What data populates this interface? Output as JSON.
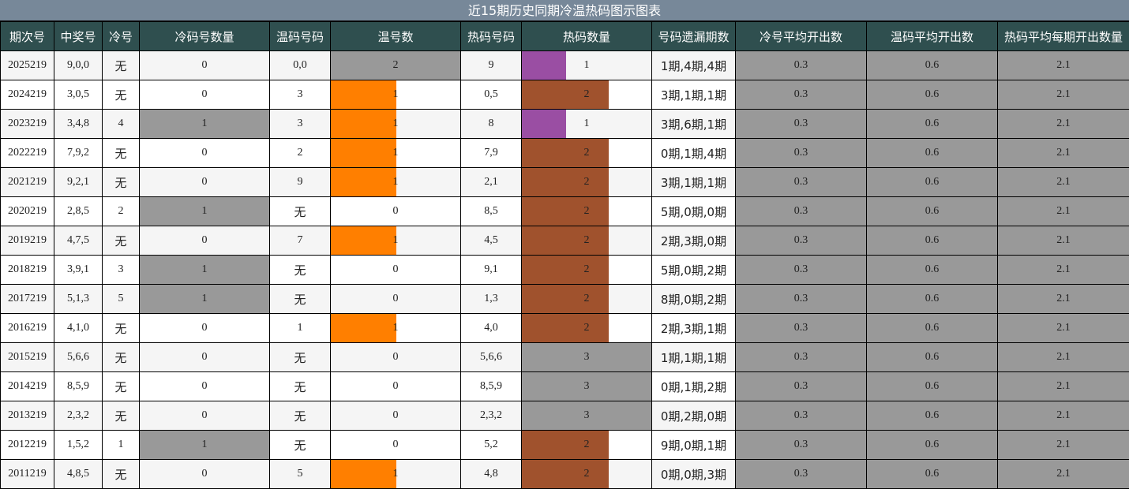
{
  "title": "近15期历史同期冷温热码图示图表",
  "headers": [
    "期次号",
    "中奖号",
    "冷号",
    "冷码号数量",
    "温码号码",
    "温号数",
    "热码号码",
    "热码数量",
    "号码遗漏期数",
    "冷号平均开出数",
    "温码平均开出数",
    "热码平均每期开出数量"
  ],
  "colors": {
    "header_bg": "#2f4f4f",
    "title_bg": "#778899",
    "warm_bar": "#ff7f00",
    "hot1_bar": "#9a4ea3",
    "hot2_bar": "#a0522d",
    "grey": "#999999"
  },
  "rows": [
    {
      "issue": "2025219",
      "draw": "9,0,0",
      "cold": "无",
      "cold_count": "0",
      "warm_nums": "0,0",
      "warm_count": "2",
      "hot_nums": "9",
      "hot_count": "1",
      "miss": "1期,4期,4期",
      "avg_cold": "0.3",
      "avg_warm": "0.6",
      "avg_hot": "2.1"
    },
    {
      "issue": "2024219",
      "draw": "3,0,5",
      "cold": "无",
      "cold_count": "0",
      "warm_nums": "3",
      "warm_count": "1",
      "hot_nums": "0,5",
      "hot_count": "2",
      "miss": "3期,1期,1期",
      "avg_cold": "0.3",
      "avg_warm": "0.6",
      "avg_hot": "2.1"
    },
    {
      "issue": "2023219",
      "draw": "3,4,8",
      "cold": "4",
      "cold_count": "1",
      "warm_nums": "3",
      "warm_count": "1",
      "hot_nums": "8",
      "hot_count": "1",
      "miss": "3期,6期,1期",
      "avg_cold": "0.3",
      "avg_warm": "0.6",
      "avg_hot": "2.1"
    },
    {
      "issue": "2022219",
      "draw": "7,9,2",
      "cold": "无",
      "cold_count": "0",
      "warm_nums": "2",
      "warm_count": "1",
      "hot_nums": "7,9",
      "hot_count": "2",
      "miss": "0期,1期,4期",
      "avg_cold": "0.3",
      "avg_warm": "0.6",
      "avg_hot": "2.1"
    },
    {
      "issue": "2021219",
      "draw": "9,2,1",
      "cold": "无",
      "cold_count": "0",
      "warm_nums": "9",
      "warm_count": "1",
      "hot_nums": "2,1",
      "hot_count": "2",
      "miss": "3期,1期,1期",
      "avg_cold": "0.3",
      "avg_warm": "0.6",
      "avg_hot": "2.1"
    },
    {
      "issue": "2020219",
      "draw": "2,8,5",
      "cold": "2",
      "cold_count": "1",
      "warm_nums": "无",
      "warm_count": "0",
      "hot_nums": "8,5",
      "hot_count": "2",
      "miss": "5期,0期,0期",
      "avg_cold": "0.3",
      "avg_warm": "0.6",
      "avg_hot": "2.1"
    },
    {
      "issue": "2019219",
      "draw": "4,7,5",
      "cold": "无",
      "cold_count": "0",
      "warm_nums": "7",
      "warm_count": "1",
      "hot_nums": "4,5",
      "hot_count": "2",
      "miss": "2期,3期,0期",
      "avg_cold": "0.3",
      "avg_warm": "0.6",
      "avg_hot": "2.1"
    },
    {
      "issue": "2018219",
      "draw": "3,9,1",
      "cold": "3",
      "cold_count": "1",
      "warm_nums": "无",
      "warm_count": "0",
      "hot_nums": "9,1",
      "hot_count": "2",
      "miss": "5期,0期,2期",
      "avg_cold": "0.3",
      "avg_warm": "0.6",
      "avg_hot": "2.1"
    },
    {
      "issue": "2017219",
      "draw": "5,1,3",
      "cold": "5",
      "cold_count": "1",
      "warm_nums": "无",
      "warm_count": "0",
      "hot_nums": "1,3",
      "hot_count": "2",
      "miss": "8期,0期,2期",
      "avg_cold": "0.3",
      "avg_warm": "0.6",
      "avg_hot": "2.1"
    },
    {
      "issue": "2016219",
      "draw": "4,1,0",
      "cold": "无",
      "cold_count": "0",
      "warm_nums": "1",
      "warm_count": "1",
      "hot_nums": "4,0",
      "hot_count": "2",
      "miss": "2期,3期,1期",
      "avg_cold": "0.3",
      "avg_warm": "0.6",
      "avg_hot": "2.1"
    },
    {
      "issue": "2015219",
      "draw": "5,6,6",
      "cold": "无",
      "cold_count": "0",
      "warm_nums": "无",
      "warm_count": "0",
      "hot_nums": "5,6,6",
      "hot_count": "3",
      "miss": "1期,1期,1期",
      "avg_cold": "0.3",
      "avg_warm": "0.6",
      "avg_hot": "2.1"
    },
    {
      "issue": "2014219",
      "draw": "8,5,9",
      "cold": "无",
      "cold_count": "0",
      "warm_nums": "无",
      "warm_count": "0",
      "hot_nums": "8,5,9",
      "hot_count": "3",
      "miss": "0期,1期,2期",
      "avg_cold": "0.3",
      "avg_warm": "0.6",
      "avg_hot": "2.1"
    },
    {
      "issue": "2013219",
      "draw": "2,3,2",
      "cold": "无",
      "cold_count": "0",
      "warm_nums": "无",
      "warm_count": "0",
      "hot_nums": "2,3,2",
      "hot_count": "3",
      "miss": "0期,2期,0期",
      "avg_cold": "0.3",
      "avg_warm": "0.6",
      "avg_hot": "2.1"
    },
    {
      "issue": "2012219",
      "draw": "1,5,2",
      "cold": "1",
      "cold_count": "1",
      "warm_nums": "无",
      "warm_count": "0",
      "hot_nums": "5,2",
      "hot_count": "2",
      "miss": "9期,0期,1期",
      "avg_cold": "0.3",
      "avg_warm": "0.6",
      "avg_hot": "2.1"
    },
    {
      "issue": "2011219",
      "draw": "4,8,5",
      "cold": "无",
      "cold_count": "0",
      "warm_nums": "5",
      "warm_count": "1",
      "hot_nums": "4,8",
      "hot_count": "2",
      "miss": "0期,0期,3期",
      "avg_cold": "0.3",
      "avg_warm": "0.6",
      "avg_hot": "2.1"
    }
  ]
}
